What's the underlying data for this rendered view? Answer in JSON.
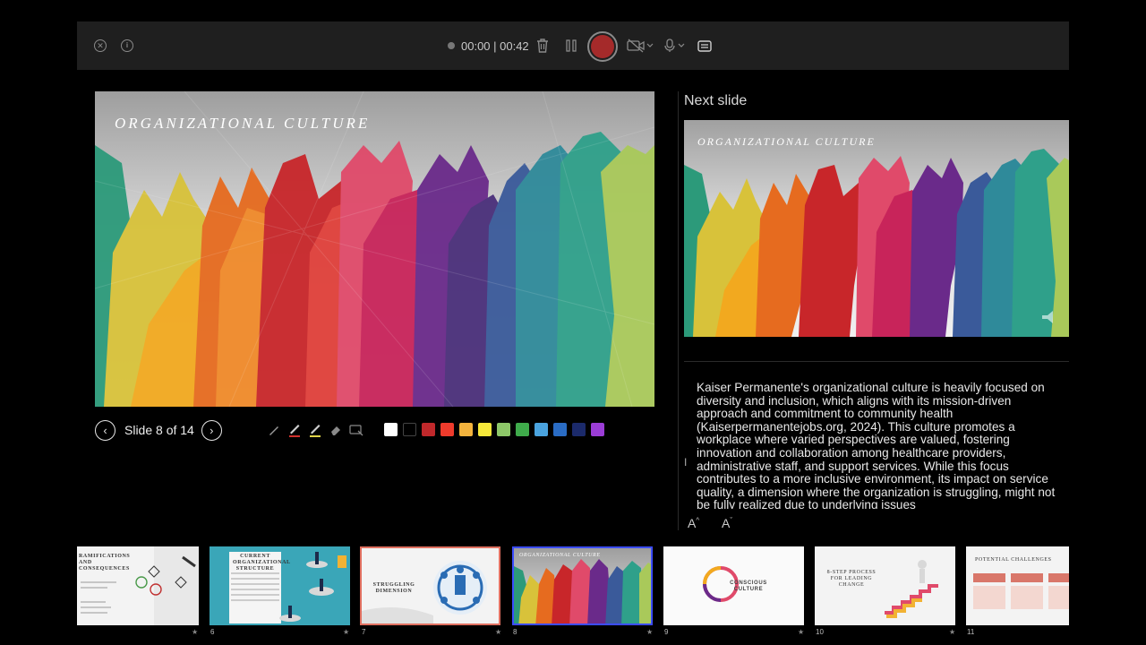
{
  "toolbar": {
    "timer": "00:00 | 00:42"
  },
  "slide": {
    "title": "ORGANIZATIONAL CULTURE",
    "counter": "Slide 8 of 14"
  },
  "ink_colors": [
    "#ffffff",
    "#000000",
    "#c0282b",
    "#ef3b2c",
    "#f3b33d",
    "#f5e83a",
    "#8dc768",
    "#3fab4b",
    "#4aa3df",
    "#2a6cc4",
    "#1b2a6b",
    "#9b3dd6"
  ],
  "next_slide": {
    "label": "Next slide",
    "title": "ORGANIZATIONAL CULTURE"
  },
  "notes": "Kaiser Permanente's organizational culture is heavily focused on diversity and inclusion, which aligns with its mission-driven approach and commitment to community health (Kaiserpermanentejobs.org, 2024). This culture promotes a workplace where varied perspectives are valued, fostering innovation and collaboration among healthcare providers, administrative staff, and support services. While this focus contributes to a more inclusive environment, its impact on service quality, a dimension where the organization is struggling, might not be fully realized due to underlying issues",
  "font_controls": [
    "A",
    "A"
  ],
  "thumbnails": [
    {
      "num": "",
      "title": "RAMIFICATIONS AND CONSEQUENCES"
    },
    {
      "num": "6",
      "title": "CURRENT ORGANIZATIONAL STRUCTURE"
    },
    {
      "num": "7",
      "title": "STRUGGLING DIMENSION"
    },
    {
      "num": "8",
      "title": "ORGANIZATIONAL CULTURE"
    },
    {
      "num": "9",
      "title": "CONSCIOUS CULTURE"
    },
    {
      "num": "10",
      "title": "8-STEP PROCESS FOR LEADING CHANGE"
    },
    {
      "num": "11",
      "title": "POTENTIAL CHALLENGES"
    }
  ],
  "star": "★"
}
